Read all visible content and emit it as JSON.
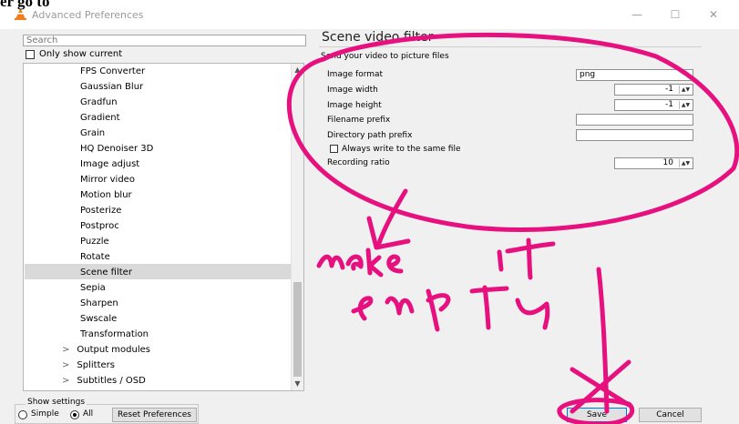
{
  "window": {
    "title": "Advanced Preferences",
    "clipped_heading": "er go to",
    "minimize_icon": "minimize-icon",
    "maximize_icon": "maximize-icon",
    "close_icon": "close-icon"
  },
  "search": {
    "placeholder": "Search"
  },
  "only_show_current": {
    "label": "Only show current",
    "checked": false
  },
  "tree": {
    "filter_items": [
      "FPS Converter",
      "Gaussian Blur",
      "Gradfun",
      "Gradient",
      "Grain",
      "HQ Denoiser 3D",
      "Image adjust",
      "Mirror video",
      "Motion blur",
      "Posterize",
      "Postproc",
      "Puzzle",
      "Rotate",
      "Scene filter",
      "Sepia",
      "Sharpen",
      "Swscale",
      "Transformation"
    ],
    "selected": "Scene filter",
    "top_items": [
      "Output modules",
      "Splitters",
      "Subtitles / OSD"
    ]
  },
  "panel": {
    "title": "Scene video filter",
    "subtitle": "Send your video to picture files",
    "options": {
      "image_format": {
        "label": "Image format",
        "value": "png"
      },
      "image_width": {
        "label": "Image width",
        "value": "-1"
      },
      "image_height": {
        "label": "Image height",
        "value": "-1"
      },
      "filename_prefix": {
        "label": "Filename prefix",
        "value": ""
      },
      "directory_path_prefix": {
        "label": "Directory path prefix",
        "value": ""
      },
      "always_write_same_file": {
        "label": "Always write to the same file",
        "checked": false
      },
      "recording_ratio": {
        "label": "Recording ratio",
        "value": "10"
      }
    }
  },
  "show_settings": {
    "label": "Show settings",
    "options": [
      "Simple",
      "All"
    ],
    "selected": "All"
  },
  "buttons": {
    "reset": "Reset Preferences",
    "save": "Save",
    "cancel": "Cancel"
  },
  "colors": {
    "annotation": "#e6117e",
    "selection": "#d9d9d9",
    "vlc_orange": "#ef7f1a"
  }
}
